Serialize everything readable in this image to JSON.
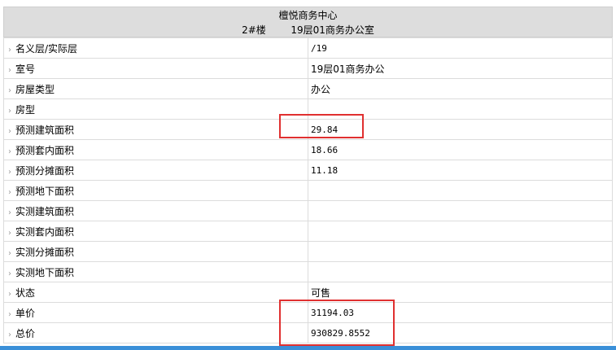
{
  "header": {
    "project": "檀悦商务中心",
    "building": "2#楼",
    "unit": "19层01商务办公室"
  },
  "rows": [
    {
      "label": "名义层/实际层",
      "value": "/19"
    },
    {
      "label": "室号",
      "value": "19层01商务办公"
    },
    {
      "label": "房屋类型",
      "value": "办公"
    },
    {
      "label": "房型",
      "value": ""
    },
    {
      "label": "预测建筑面积",
      "value": "29.84"
    },
    {
      "label": "预测套内面积",
      "value": "18.66"
    },
    {
      "label": "预测分摊面积",
      "value": "11.18"
    },
    {
      "label": "预测地下面积",
      "value": ""
    },
    {
      "label": "实测建筑面积",
      "value": ""
    },
    {
      "label": "实测套内面积",
      "value": ""
    },
    {
      "label": "实测分摊面积",
      "value": ""
    },
    {
      "label": "实测地下面积",
      "value": ""
    },
    {
      "label": "状态",
      "value": "可售"
    },
    {
      "label": "单价",
      "value": "31194.03"
    },
    {
      "label": "总价",
      "value": "930829.8552"
    }
  ],
  "arrow_icon": "›",
  "colors": {
    "header_bg": "#dddddd",
    "highlight": "#e03030",
    "accent_bar": "#3a8fd8"
  }
}
